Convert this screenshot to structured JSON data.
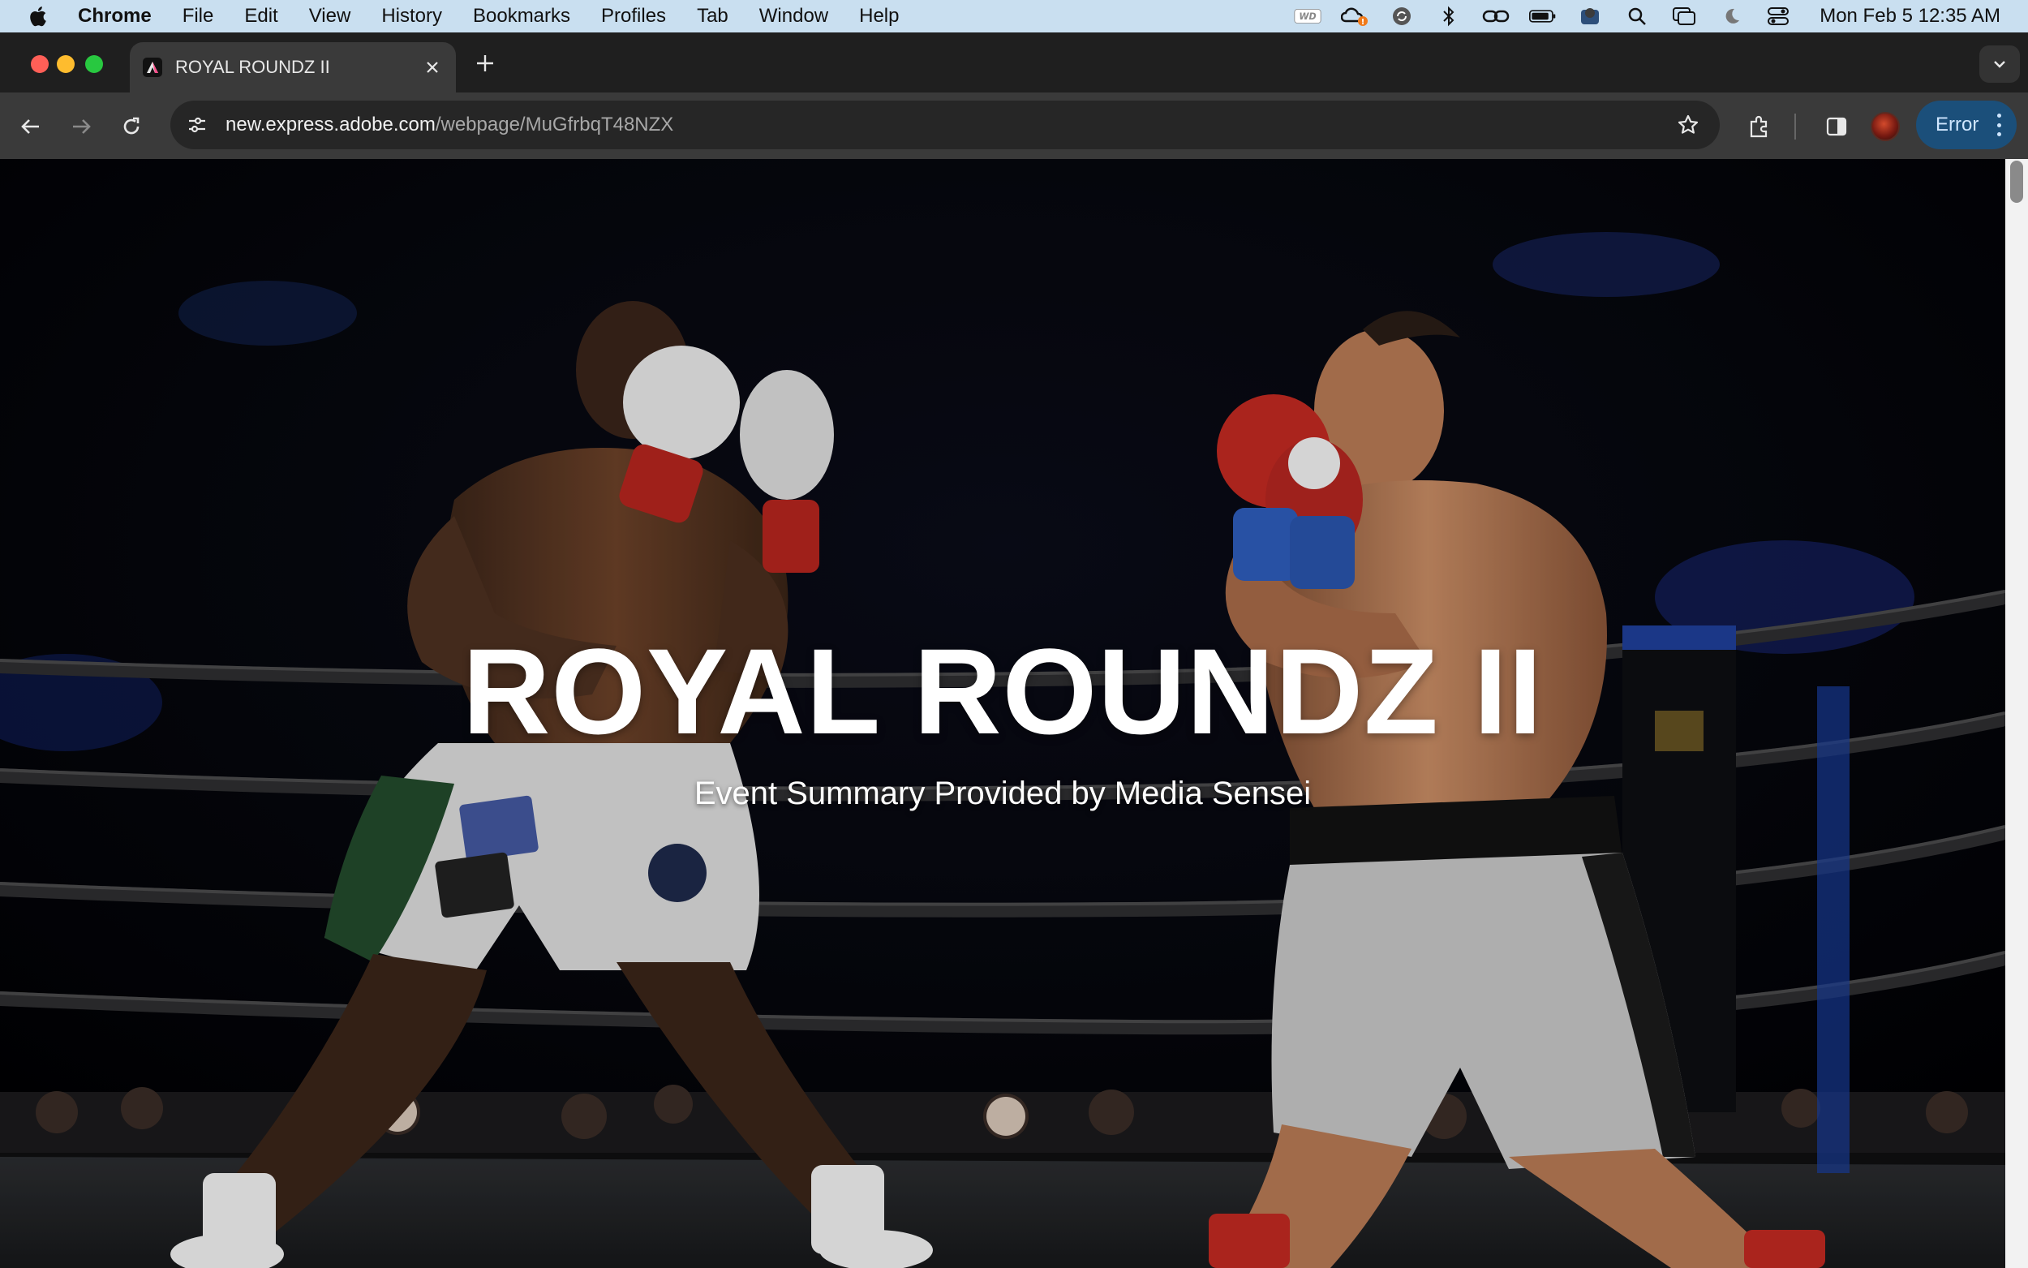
{
  "menubar": {
    "app_name": "Chrome",
    "items": [
      "File",
      "Edit",
      "View",
      "History",
      "Bookmarks",
      "Profiles",
      "Tab",
      "Window",
      "Help"
    ],
    "clock": "Mon Feb 5  12:35 AM",
    "tray_icons": [
      "wd-icon",
      "creative-cloud-icon",
      "sync-icon",
      "bluetooth-icon",
      "link-icon",
      "battery-icon",
      "user-badge-icon",
      "spotlight-icon",
      "screen-mirroring-icon",
      "focus-moon-icon",
      "control-center-icon"
    ]
  },
  "browser": {
    "tab_title": "ROYAL ROUNDZ II",
    "url_host": "new.express.adobe.com",
    "url_path": "/webpage/MuGfrbqT48NZX",
    "error_label": "Error"
  },
  "page": {
    "title": "ROYAL ROUNDZ II",
    "subtitle": "Event Summary Provided by Media Sensei"
  },
  "colors": {
    "menubar_bg": "#c9dff0",
    "tabstrip_bg": "#1f1f1f",
    "toolbar_bg": "#3a3a3a",
    "error_chip_bg": "#1b4f7a"
  }
}
